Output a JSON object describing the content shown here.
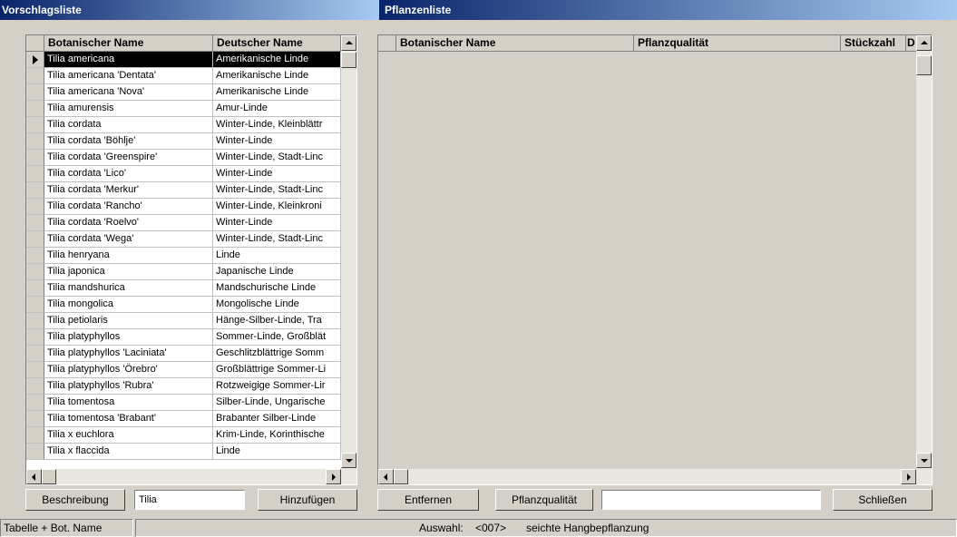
{
  "left_panel": {
    "title": "Vorschlagsliste",
    "columns": [
      "Botanischer Name",
      "Deutscher Name"
    ],
    "rows": [
      {
        "bot": "Tilia americana",
        "de": "Amerikanische Linde",
        "active": true
      },
      {
        "bot": "Tilia americana 'Dentata'",
        "de": "Amerikanische Linde"
      },
      {
        "bot": "Tilia americana 'Nova'",
        "de": "Amerikanische Linde"
      },
      {
        "bot": "Tilia amurensis",
        "de": "Amur-Linde"
      },
      {
        "bot": "Tilia cordata",
        "de": "Winter-Linde, Kleinblättr"
      },
      {
        "bot": "Tilia cordata 'Böhlje'",
        "de": "Winter-Linde"
      },
      {
        "bot": "Tilia cordata 'Greenspire'",
        "de": "Winter-Linde, Stadt-Linc"
      },
      {
        "bot": "Tilia cordata 'Lico'",
        "de": "Winter-Linde"
      },
      {
        "bot": "Tilia cordata 'Merkur'",
        "de": "Winter-Linde, Stadt-Linc"
      },
      {
        "bot": "Tilia cordata 'Rancho'",
        "de": "Winter-Linde, Kleinkroni"
      },
      {
        "bot": "Tilia cordata 'Roelvo'",
        "de": "Winter-Linde"
      },
      {
        "bot": "Tilia cordata 'Wega'",
        "de": "Winter-Linde, Stadt-Linc"
      },
      {
        "bot": "Tilia henryana",
        "de": "Linde"
      },
      {
        "bot": "Tilia japonica",
        "de": "Japanische Linde"
      },
      {
        "bot": "Tilia mandshurica",
        "de": "Mandschurische Linde"
      },
      {
        "bot": "Tilia mongolica",
        "de": "Mongolische Linde"
      },
      {
        "bot": "Tilia petiolaris",
        "de": "Hänge-Silber-Linde, Tra"
      },
      {
        "bot": "Tilia platyphyllos",
        "de": "Sommer-Linde, Großblät"
      },
      {
        "bot": "Tilia platyphyllos 'Laciniata'",
        "de": "Geschlitzblättrige Somm"
      },
      {
        "bot": "Tilia platyphyllos 'Örebro'",
        "de": "Großblättrige Sommer-Li"
      },
      {
        "bot": "Tilia platyphyllos 'Rubra'",
        "de": "Rotzweigige Sommer-Lir"
      },
      {
        "bot": "Tilia tomentosa",
        "de": "Silber-Linde, Ungarische"
      },
      {
        "bot": "Tilia tomentosa 'Brabant'",
        "de": "Brabanter Silber-Linde"
      },
      {
        "bot": "Tilia x euchlora",
        "de": "Krim-Linde, Korinthische"
      },
      {
        "bot": "Tilia x flaccida",
        "de": "Linde"
      }
    ],
    "buttons": {
      "beschreibung": "Beschreibung",
      "hinzufuegen": "Hinzufügen"
    },
    "search_value": "Tilia"
  },
  "right_panel": {
    "title": "Pflanzenliste",
    "columns": [
      "Botanischer Name",
      "Pflanzqualität",
      "Stückzahl",
      "D"
    ],
    "buttons": {
      "entfernen": "Entfernen",
      "pflanzqualitaet": "Pflanzqualität",
      "schliessen": "Schließen"
    },
    "field_value": ""
  },
  "status": {
    "mode": "Tabelle + Bot. Name",
    "auswahl_label": "Auswahl:",
    "auswahl_value": "<007>",
    "description": "seichte Hangbepflanzung"
  },
  "colors": {
    "title_start": "#0a246a",
    "title_end": "#a6caf0",
    "face": "#d4d0c8",
    "selection": "#000000"
  }
}
